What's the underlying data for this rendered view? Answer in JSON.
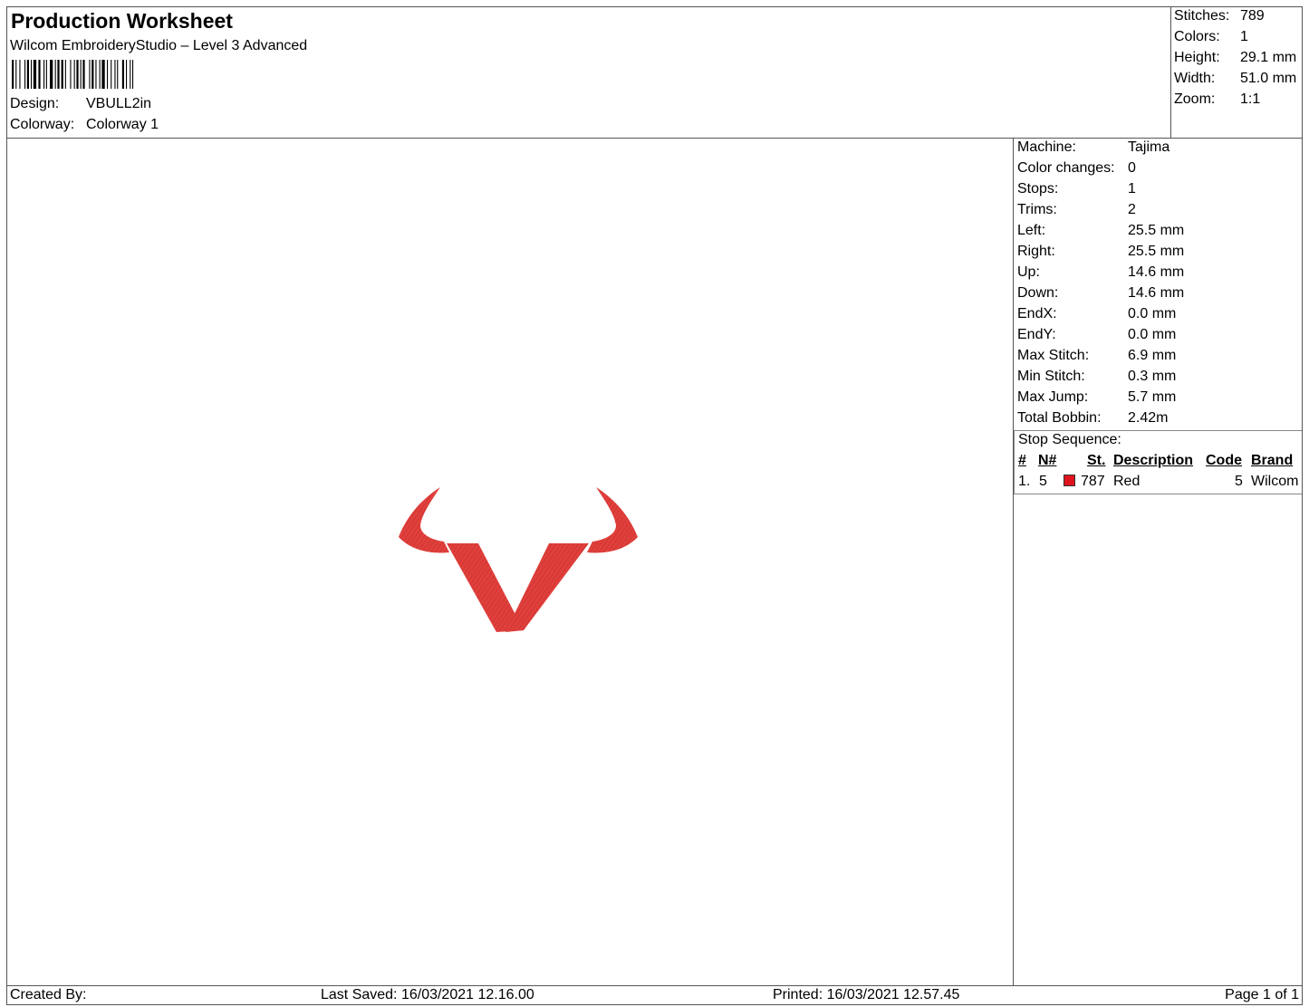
{
  "header": {
    "title": "Production Worksheet",
    "software": "Wilcom EmbroideryStudio – Level 3 Advanced",
    "design_label": "Design:",
    "design_value": "VBULL2in",
    "colorway_label": "Colorway:",
    "colorway_value": "Colorway 1"
  },
  "stats": {
    "stitches_label": "Stitches:",
    "stitches_value": "789",
    "colors_label": "Colors:",
    "colors_value": "1",
    "height_label": "Height:",
    "height_value": "29.1 mm",
    "width_label": "Width:",
    "width_value": "51.0 mm",
    "zoom_label": "Zoom:",
    "zoom_value": "1:1"
  },
  "details": [
    {
      "label": "Machine:",
      "value": "Tajima"
    },
    {
      "label": "Color changes:",
      "value": "0"
    },
    {
      "label": "Stops:",
      "value": "1"
    },
    {
      "label": "Trims:",
      "value": "2"
    },
    {
      "label": "Left:",
      "value": "25.5 mm"
    },
    {
      "label": "Right:",
      "value": "25.5 mm"
    },
    {
      "label": "Up:",
      "value": "14.6 mm"
    },
    {
      "label": "Down:",
      "value": "14.6 mm"
    },
    {
      "label": "EndX:",
      "value": "0.0 mm"
    },
    {
      "label": "EndY:",
      "value": "0.0 mm"
    },
    {
      "label": "Max Stitch:",
      "value": "6.9 mm"
    },
    {
      "label": "Min Stitch:",
      "value": "0.3 mm"
    },
    {
      "label": "Max Jump:",
      "value": "5.7 mm"
    },
    {
      "label": "Total Bobbin:",
      "value": "2.42m"
    }
  ],
  "stop_sequence": {
    "label": "Stop Sequence:",
    "columns": {
      "num": "#",
      "needle": "N#",
      "stitches": "St.",
      "description": "Description",
      "code": "Code",
      "brand": "Brand"
    },
    "rows": [
      {
        "num": "1.",
        "needle": "5",
        "stitches": "787",
        "description": "Red",
        "code": "5",
        "brand": "Wilcom",
        "color": "#e0141e"
      }
    ]
  },
  "design_colors": {
    "thread": "#e0403c",
    "thread_dark": "#c42a2a"
  },
  "footer": {
    "created_by": "Created By:",
    "last_saved": "Last Saved: 16/03/2021 12.16.00",
    "printed": "Printed: 16/03/2021 12.57.45",
    "page": "Page 1 of 1"
  }
}
